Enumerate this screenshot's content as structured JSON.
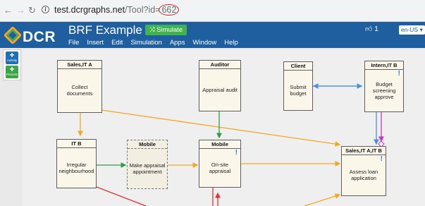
{
  "browser": {
    "url_host": "test.dcrgraphs.net",
    "url_path": "/Tool?id=",
    "url_id": "662"
  },
  "header": {
    "logo": "DCR",
    "title": "BRF Example",
    "simulate_label": "Simulate",
    "menu": [
      "File",
      "Insert",
      "Edit",
      "Simulation",
      "Apps",
      "Window",
      "Help"
    ],
    "likes": "1",
    "language": "en-US"
  },
  "tools": {
    "activity": "Activity",
    "process": "Process"
  },
  "events": [
    {
      "id": "e1",
      "role": "Sales,IT A",
      "label": "Collect documents",
      "pending": false,
      "dashed": false
    },
    {
      "id": "e2",
      "role": "Auditor",
      "label": "Appraisal audit",
      "pending": false,
      "dashed": false
    },
    {
      "id": "e3",
      "role": "Client",
      "label": "Submit budget",
      "pending": false,
      "dashed": false
    },
    {
      "id": "e4",
      "role": "Intern,IT B",
      "label": "Budget screening approve",
      "pending": true,
      "dashed": false
    },
    {
      "id": "e5",
      "role": "IT B",
      "label": "Irregular neighbourhood",
      "pending": false,
      "dashed": false
    },
    {
      "id": "e6",
      "role": "Mobile",
      "label": "Make appraisal appointment",
      "pending": false,
      "dashed": true
    },
    {
      "id": "e7",
      "role": "Mobile",
      "label": "On-site appraisal",
      "pending": true,
      "dashed": false
    },
    {
      "id": "e8",
      "role": "Sales,IT A,IT B",
      "label": "Assess loan application",
      "pending": true,
      "dashed": false
    }
  ],
  "colors": {
    "header_bg": "#1f5fa0",
    "condition": "#f5a623",
    "response": "#2f9e44",
    "include": "#4a90e2",
    "exclude": "#e03131",
    "milestone": "#cc33cc"
  }
}
